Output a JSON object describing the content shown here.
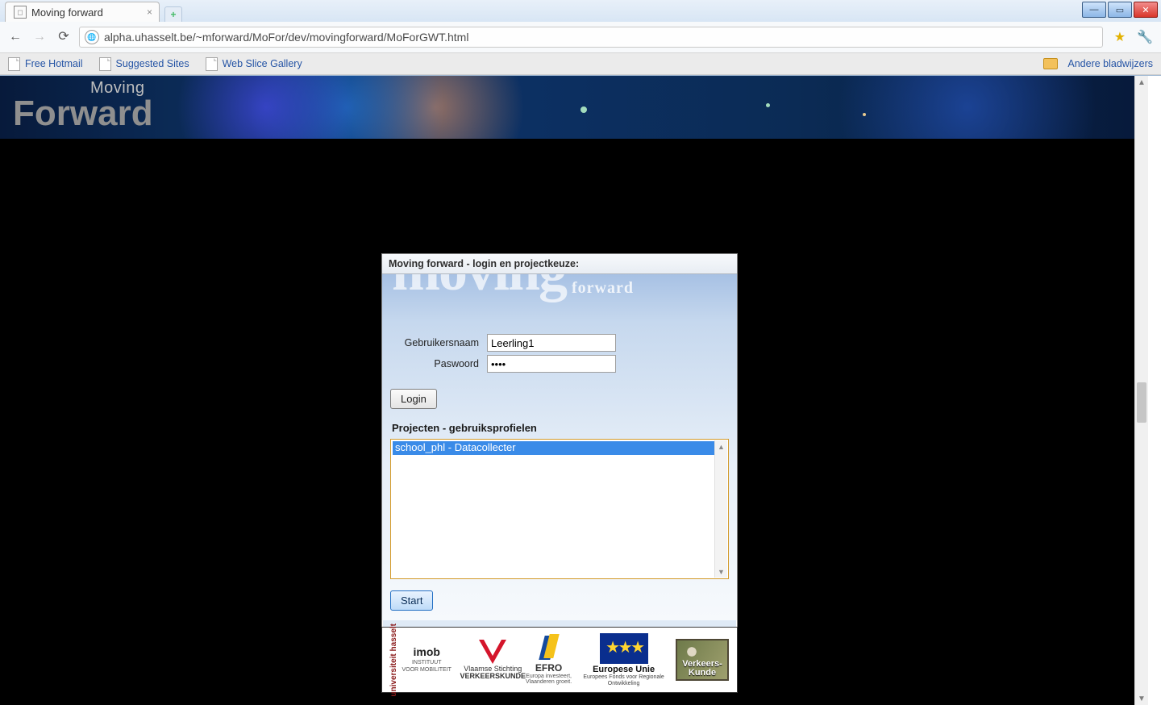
{
  "browser": {
    "tab_title": "Moving forward",
    "url": "alpha.uhasselt.be/~mforward/MoFor/dev/movingforward/MoForGWT.html",
    "bookmarks": [
      "Free Hotmail",
      "Suggested Sites",
      "Web Slice Gallery"
    ],
    "other_bookmarks_label": "Andere bladwijzers"
  },
  "banner": {
    "top_word": "Moving",
    "bottom_word": "Forward"
  },
  "dialog": {
    "title": "Moving forward - login en projectkeuze:",
    "logo_big": "moving",
    "logo_small": "forward",
    "username_label": "Gebruikersnaam",
    "username_value": "Leerling1",
    "password_label": "Paswoord",
    "password_value": "••••",
    "login_btn": "Login",
    "projects_label": "Projecten - gebruiksprofielen",
    "projects": [
      "school_phl - Datacollecter"
    ],
    "start_btn": "Start"
  },
  "sponsors": {
    "uh_vert": "universiteit hasselt",
    "imob": "imob",
    "imob_sub": "INSTITUUT\nVOOR MOBILITEIT",
    "vsv_line1": "Vlaamse Stichting",
    "vsv_line2": "VERKEERSKUNDE",
    "efro_name": "EFRO",
    "efro_sub": "Europa investeert,\nVlaanderen groeit.",
    "eu_title": "Europese Unie",
    "eu_sub": "Europees Fonds voor Regionale Ontwikkeling",
    "vk_line1": "Verkeers-",
    "vk_line2": "Kunde"
  }
}
